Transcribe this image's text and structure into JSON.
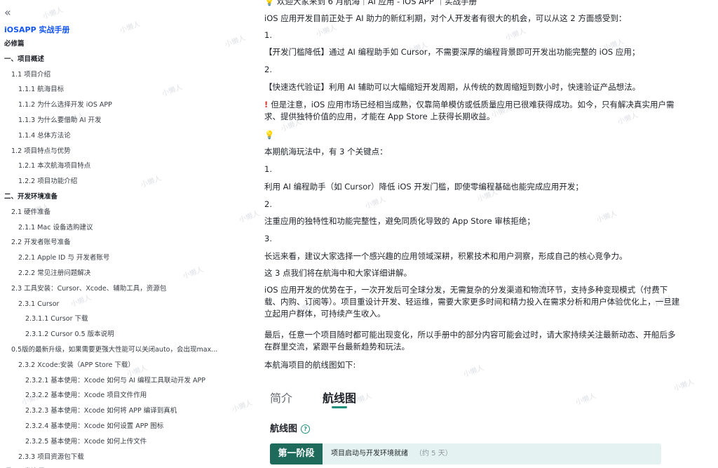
{
  "watermark": "小懒人",
  "sidebar": {
    "collapse_glyph": "«",
    "doc_title": "iOSAPP 实战手册",
    "toc": [
      {
        "label": "必修篇",
        "level": 0
      },
      {
        "label": "一、项目概述",
        "level": 0
      },
      {
        "label": "1.1 项目介绍",
        "level": 1
      },
      {
        "label": "1.1.1 航海目标",
        "level": 2
      },
      {
        "label": "1.1.2 为什么选择开发 iOS APP",
        "level": 2
      },
      {
        "label": "1.1.3 为什么要借助 AI 开发",
        "level": 2
      },
      {
        "label": "1.1.4 总体方法论",
        "level": 2
      },
      {
        "label": "1.2 项目特点与优势",
        "level": 1
      },
      {
        "label": "1.2.1 本次航海项目特点",
        "level": 2
      },
      {
        "label": "1.2.2 项目功能介绍",
        "level": 2
      },
      {
        "label": "二、开发环境准备",
        "level": 0
      },
      {
        "label": "2.1 硬件准备",
        "level": 1
      },
      {
        "label": "2.1.1 Mac 设备选购建议",
        "level": 2
      },
      {
        "label": "2.2 开发者账号准备",
        "level": 1
      },
      {
        "label": "2.2.1 Apple ID 与 开发者账号",
        "level": 2
      },
      {
        "label": "2.2.2 常见注册问题解决",
        "level": 2
      },
      {
        "label": "2.3 工具安装：Cursor、Xcode、辅助工具，资源包",
        "level": 1
      },
      {
        "label": "2.3.1 Cursor",
        "level": 2
      },
      {
        "label": "2.3.1.1 Cursor 下载",
        "level": 3
      },
      {
        "label": "2.3.1.2 Cursor 0.5 版本说明",
        "level": 3
      },
      {
        "label": "0.5版的最新升级，如果需要更强大性能可以关闭auto，会出现max...",
        "level": 9
      },
      {
        "label": "2.3.2 Xcode:安装（APP Store 下载）",
        "level": 2
      },
      {
        "label": "2.3.2.1 基本使用：Xcode 如何与 AI 编程工具联动开发 APP",
        "level": 3
      },
      {
        "label": "2.3.2.2 基本使用：Xcode 项目文件作用",
        "level": 3
      },
      {
        "label": "2.3.2.3 基本使用：Xcode 如何将 APP 编译到真机",
        "level": 3
      },
      {
        "label": "2.3.2.4 基本使用：Xcode 如何设置 APP 图标",
        "level": 3
      },
      {
        "label": "2.3.2.5 基本使用：Xcode 如何上传文件",
        "level": 3
      },
      {
        "label": "2.3.3 项目资源包下载",
        "level": 2
      },
      {
        "label": "项目开发流程",
        "level": 0
      }
    ]
  },
  "main": {
    "welcome": "💡 欢迎大家来到 6 月航海｜AI 应用 - iOS APP ｜实战手册",
    "intro": "iOS 应用开发目前正处于 AI 助力的新红利期，对个人开发者有很大的机会，可以从这 2 方面感受到：",
    "n1": "1.",
    "p1": "【开发门槛降低】通过 AI 编程助手如 Cursor，不需要深厚的编程背景即可开发出功能完整的 iOS 应用；",
    "n2": "2.",
    "p2": "【快速迭代验证】利用 AI 辅助可以大幅缩短开发周期，从传统的数周缩短到数小时，快速验证产品想法。",
    "warn_mark": "!",
    "warn": "但是注意，iOS 应用市场已经相当成熟，仅靠简单模仿或低质量应用已很难获得成功。如今，只有解决真实用户需求、提供独特价值的应用，才能在 App Store 上获得长期收益。",
    "bulb": "💡",
    "key_intro": "本期航海玩法中，有 3 个关键点：",
    "k1n": "1.",
    "k1": "利用 AI 编程助手（如 Cursor）降低 iOS 开发门槛，即使零编程基础也能完成应用开发；",
    "k2n": "2.",
    "k2": "注重应用的独特性和功能完整性，避免同质化导致的 App Store 审核拒绝；",
    "k3n": "3.",
    "k3": "长远来看，建议大家选择一个感兴趣的应用领域深耕，积累技术和用户洞察，形成自己的核心竞争力。",
    "k_summary": "这 3 点我们将在航海中和大家详细讲解。",
    "advantage": "iOS 应用开发的优势在于，一次开发后可全球分发，无需复杂的分发渠道和物流环节，支持多种变现模式（付费下载、内购、订阅等）。项目重设计开发、轻运维，需要大家更多时间和精力投入在需求分析和用户体验优化上，一旦建立起用户群体，可持续产生收入。",
    "final": "最后，任意一个项目随时都可能出现变化，所以手册中的部分内容可能会过时，请大家持续关注最新动态、开船后多在群里交流，紧跟平台最新趋势和玩法。",
    "map_intro": "本航海项目的航线图如下:"
  },
  "roadmap": {
    "tab_intro": "简介",
    "tab_route": "航线图",
    "section_title": "航线图",
    "phase_label": "第一阶段",
    "phase_desc": "项目启动与开发环境就绪",
    "phase_duration": "（约 5 天）"
  }
}
